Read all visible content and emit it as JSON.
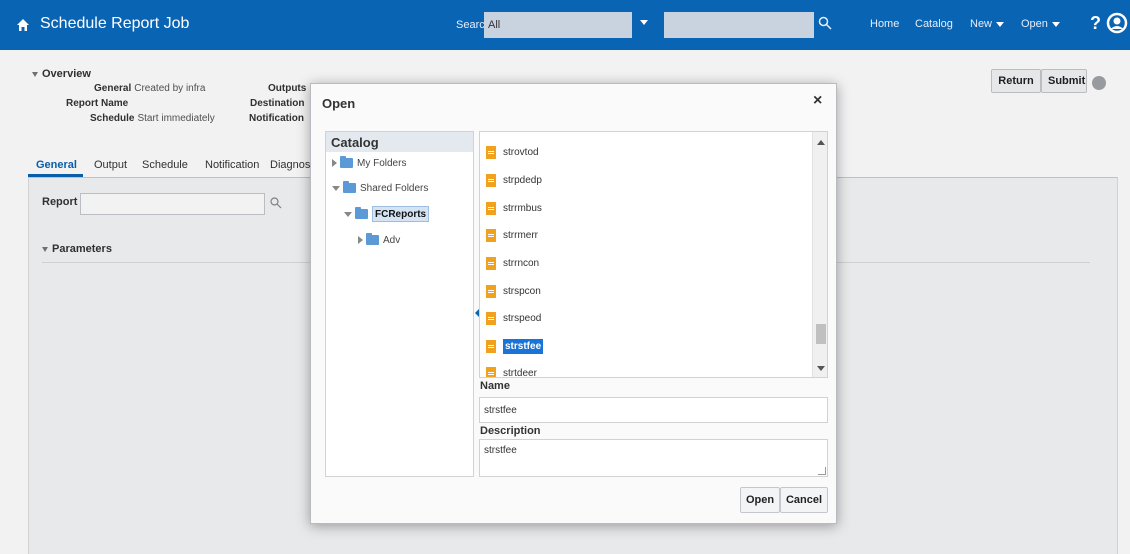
{
  "topbar": {
    "title": "Schedule Report Job",
    "search_label": "Search",
    "search_scope": "All",
    "nav": {
      "home": "Home",
      "catalog": "Catalog",
      "new": "New",
      "open": "Open"
    },
    "help": "?",
    "brand_color": "#0a64b4"
  },
  "overview": {
    "heading": "Overview",
    "general_label": "General",
    "general_value": "Created by infra",
    "report_name_label": "Report Name",
    "schedule_label": "Schedule",
    "schedule_value": "Start immediately",
    "outputs_label": "Outputs",
    "destination_label": "Destination",
    "notification_label": "Notification"
  },
  "actions": {
    "return": "Return",
    "submit": "Submit"
  },
  "tabs": [
    "General",
    "Output",
    "Schedule",
    "Notification",
    "Diagnos"
  ],
  "general_tab": {
    "report_label": "Report",
    "parameters_heading": "Parameters"
  },
  "dialog": {
    "title": "Open",
    "close": "×",
    "catalog_heading": "Catalog",
    "tree": {
      "my_folders": "My Folders",
      "shared_folders": "Shared Folders",
      "fcreports": "FCReports",
      "adv": "Adv"
    },
    "files": [
      "strovtod",
      "strpdedp",
      "strrmbus",
      "strrmerr",
      "strrncon",
      "strspcon",
      "strspeod",
      "strstfee",
      "strtdeer"
    ],
    "selected_file": "strstfee",
    "name_label": "Name",
    "name_value": "strstfee",
    "description_label": "Description",
    "description_value": "strstfee",
    "open_button": "Open",
    "cancel_button": "Cancel"
  }
}
